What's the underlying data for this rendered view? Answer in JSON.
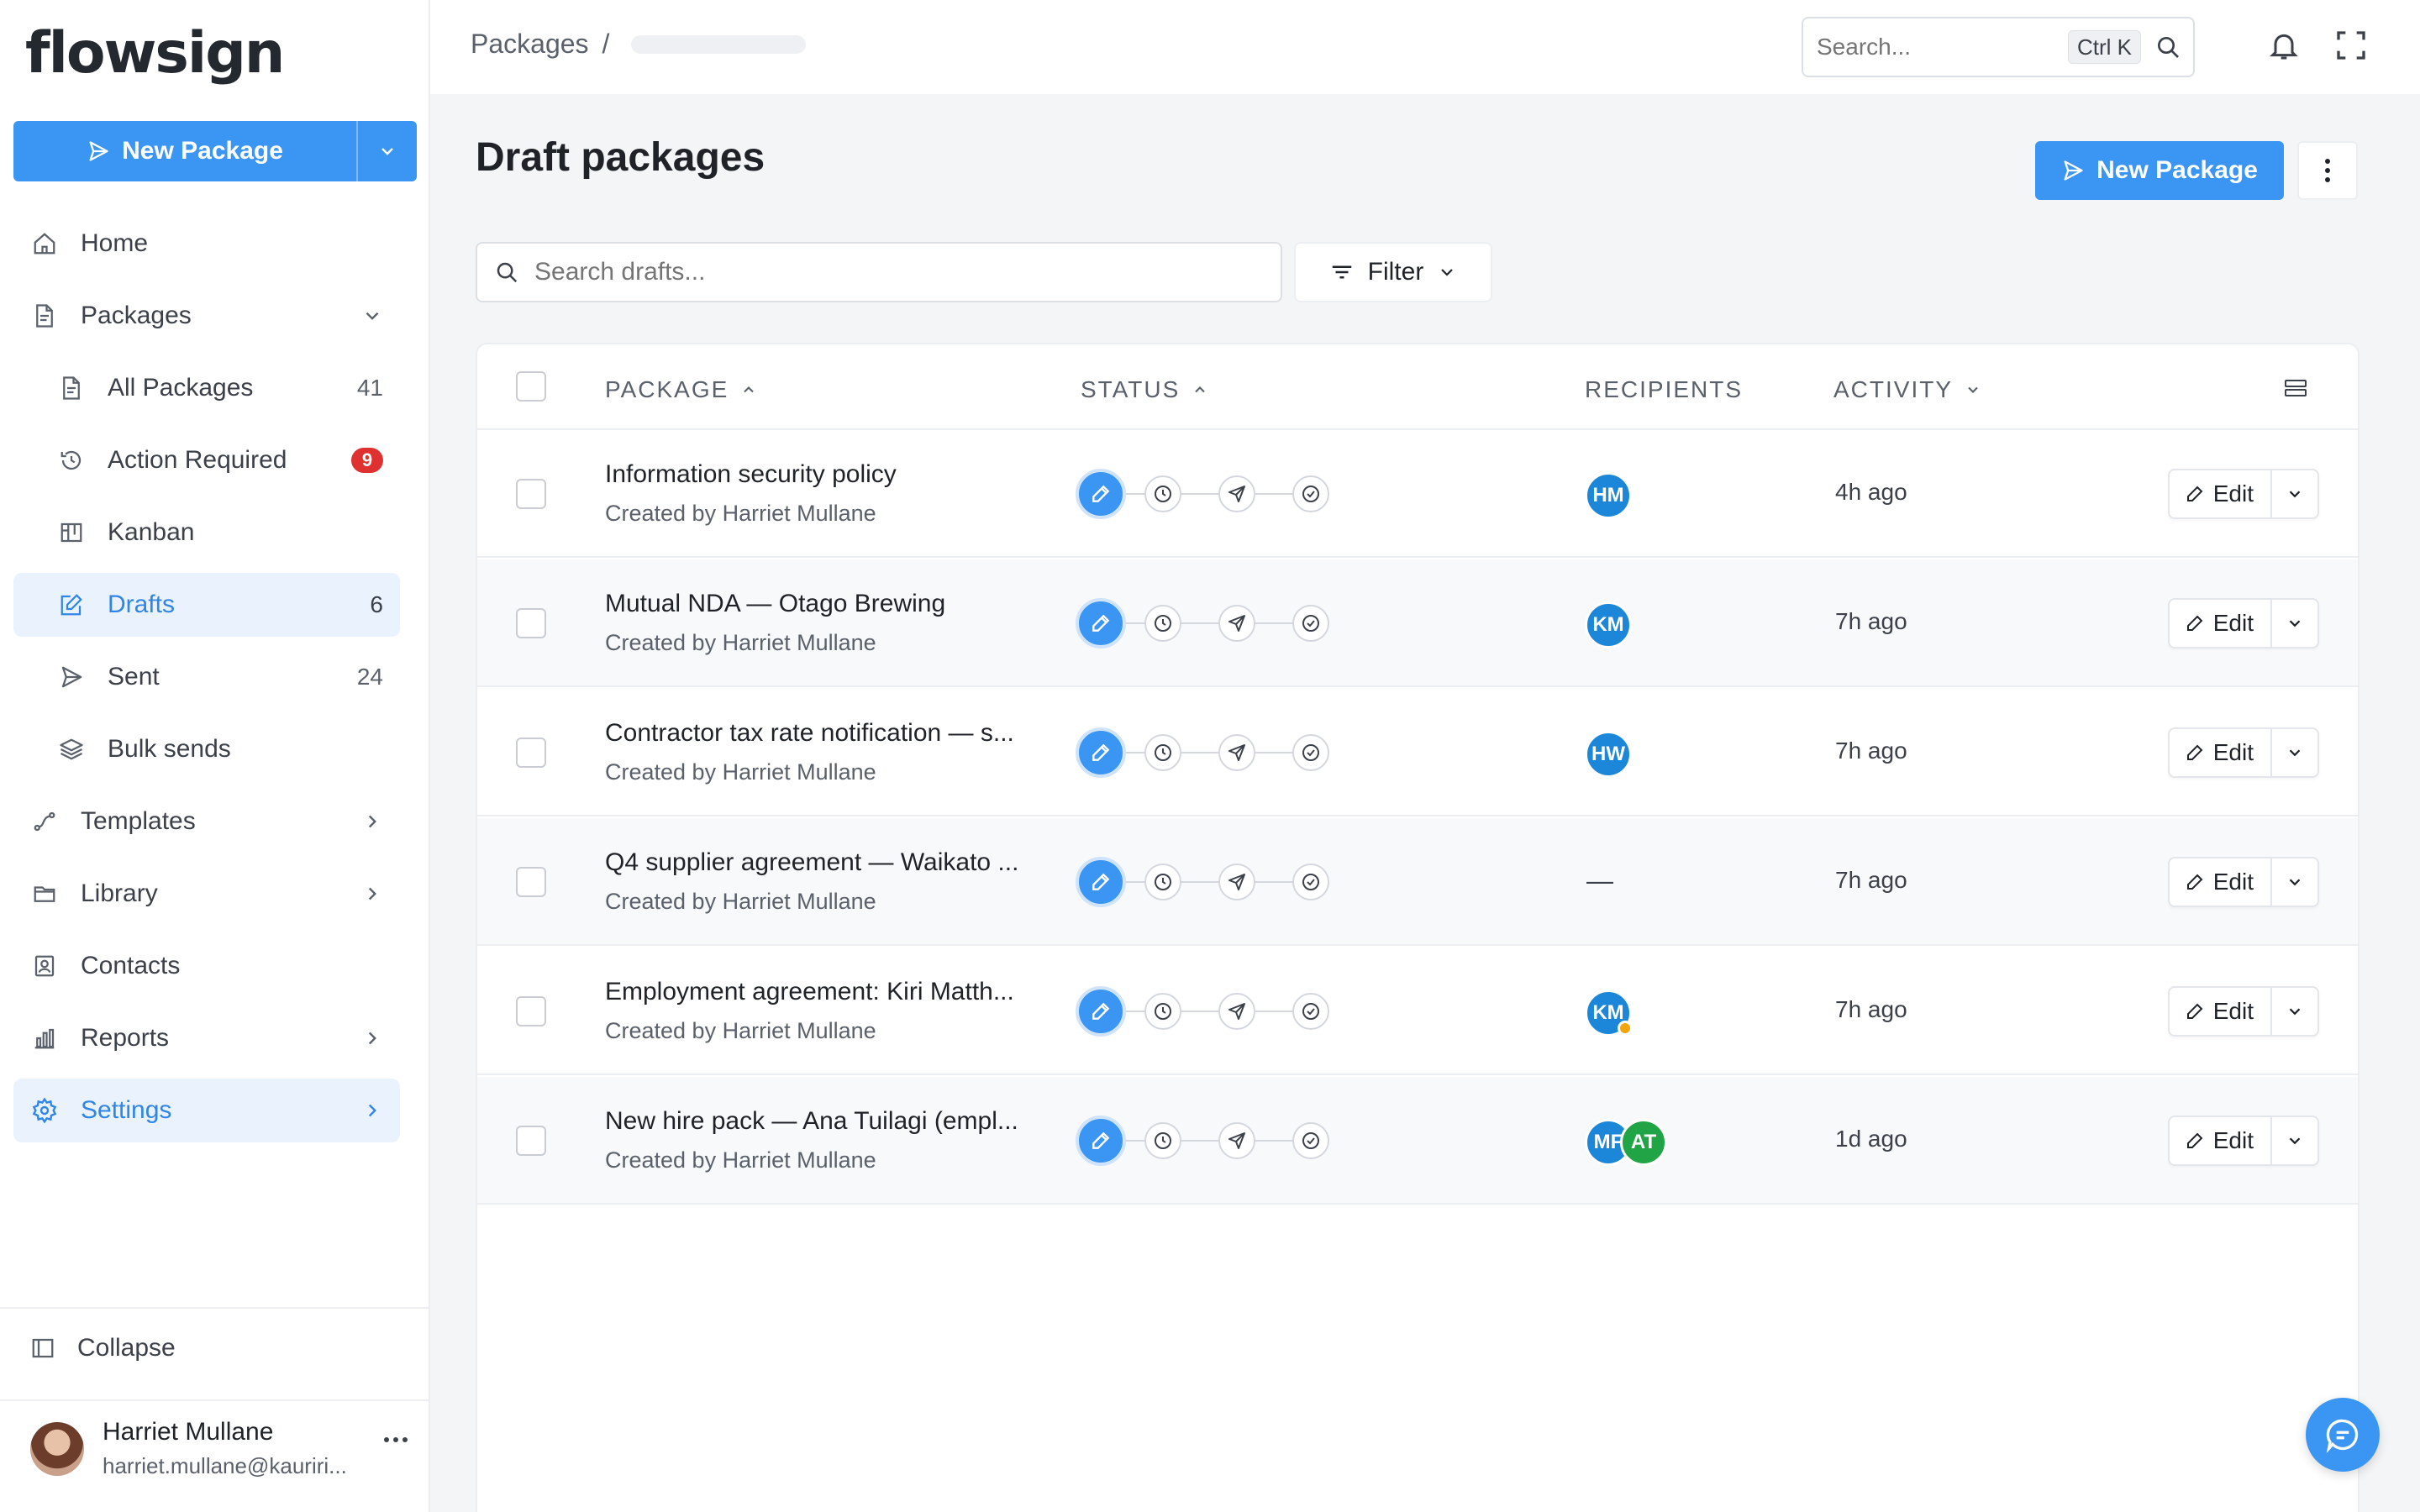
{
  "app": {
    "logo": "flowsign"
  },
  "sidebar": {
    "new_package_label": "New Package",
    "items": [
      {
        "label": "Home",
        "icon": "home-icon"
      },
      {
        "label": "Packages",
        "icon": "document-icon"
      },
      {
        "label": "All Packages",
        "count": "41",
        "icon": "document-icon"
      },
      {
        "label": "Action Required",
        "badge": "9",
        "icon": "history-icon"
      },
      {
        "label": "Kanban",
        "icon": "kanban-icon"
      },
      {
        "label": "Drafts",
        "count": "6",
        "icon": "edit-square-icon"
      },
      {
        "label": "Sent",
        "count": "24",
        "icon": "send-icon"
      },
      {
        "label": "Bulk sends",
        "icon": "layers-icon"
      },
      {
        "label": "Templates",
        "icon": "route-icon"
      },
      {
        "label": "Library",
        "icon": "folder-icon"
      },
      {
        "label": "Contacts",
        "icon": "contact-icon"
      },
      {
        "label": "Reports",
        "icon": "bar-chart-icon"
      },
      {
        "label": "Settings",
        "icon": "gear-icon"
      }
    ],
    "collapse_label": "Collapse",
    "user": {
      "name": "Harriet Mullane",
      "email": "harriet.mullane@kauriri..."
    }
  },
  "topbar": {
    "breadcrumb_root": "Packages",
    "breadcrumb_sep": "/",
    "search_placeholder": "Search...",
    "search_shortcut": "Ctrl K"
  },
  "main": {
    "title": "Draft packages",
    "new_package_label": "New Package",
    "search_placeholder": "Search drafts...",
    "filter_label": "Filter",
    "columns": {
      "package": "PACKAGE",
      "status": "STATUS",
      "recipients": "RECIPIENTS",
      "activity": "ACTIVITY"
    },
    "edit_label": "Edit",
    "rows": [
      {
        "name": "Information security policy",
        "by": "Created by Harriet Mullane",
        "recipients": [
          "HM"
        ],
        "activity": "4h ago"
      },
      {
        "name": "Mutual NDA — Otago Brewing",
        "by": "Created by Harriet Mullane",
        "recipients": [
          "KM"
        ],
        "activity": "7h ago"
      },
      {
        "name": "Contractor tax rate notification — s...",
        "by": "Created by Harriet Mullane",
        "recipients": [
          "HW"
        ],
        "activity": "7h ago"
      },
      {
        "name": "Q4 supplier agreement — Waikato ...",
        "by": "Created by Harriet Mullane",
        "recipients": [],
        "recipients_empty": "—",
        "activity": "7h ago"
      },
      {
        "name": "Employment agreement: Kiri Matth...",
        "by": "Created by Harriet Mullane",
        "recipients": [
          "KM"
        ],
        "activity": "7h ago"
      },
      {
        "name": "New hire pack — Ana Tuilagi (empl...",
        "by": "Created by Harriet Mullane",
        "recipients": [
          "MF",
          "AT"
        ],
        "activity": "1d ago"
      }
    ]
  },
  "colors": {
    "accent": "#3b95f2",
    "badge": "#e03131",
    "avatar_blue": "#1c87d9",
    "avatar_green": "#20a445",
    "presence": "#f2a60c"
  }
}
